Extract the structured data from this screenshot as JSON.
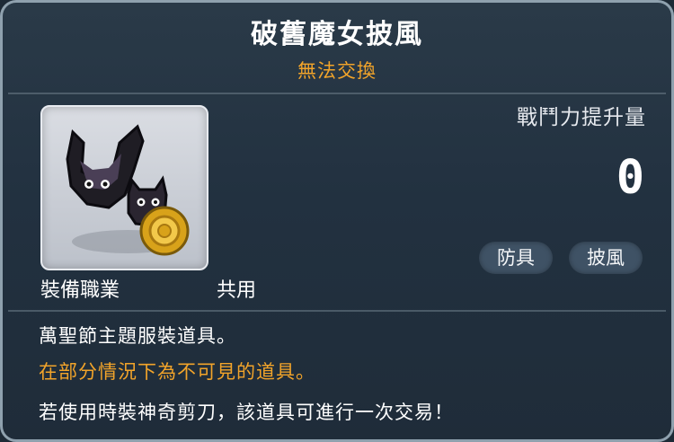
{
  "item": {
    "name": "破舊魔女披風",
    "trade_status": "無法交換",
    "icon": "witch-cat-cape-icon"
  },
  "job": {
    "label": "裝備職業",
    "value": "共用"
  },
  "power": {
    "label": "戰鬥力提升量",
    "value": "0"
  },
  "tags": [
    "防具",
    "披風"
  ],
  "description": {
    "line1": "萬聖節主題服裝道具。",
    "line2": "在部分情況下為不可見的道具。",
    "line3": "若使用時裝神奇剪刀，該道具可進行一次交易！"
  },
  "colors": {
    "background": "#223140",
    "border": "#8fa1ae",
    "highlight": "#f2a42a",
    "text": "#ffffff"
  }
}
